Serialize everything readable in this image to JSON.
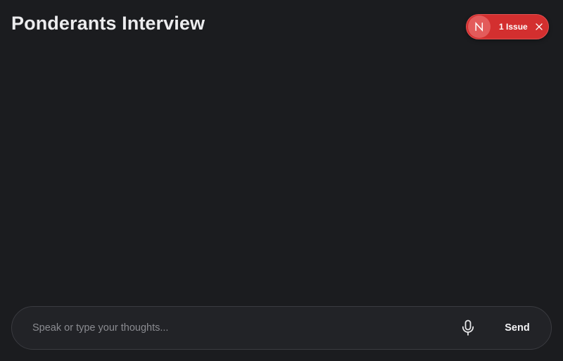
{
  "header": {
    "title": "Ponderants Interview"
  },
  "dev_overlay": {
    "badge_letter": "N",
    "issues_label": "1 Issue",
    "close_icon": "close-icon",
    "accent_color": "#d32f2f"
  },
  "composer": {
    "placeholder": "Speak or type your thoughts...",
    "value": "",
    "mic_icon": "microphone-icon",
    "send_label": "Send"
  },
  "colors": {
    "background": "#1b1c1f",
    "input_background": "#222327",
    "input_border": "#3a3b40"
  }
}
